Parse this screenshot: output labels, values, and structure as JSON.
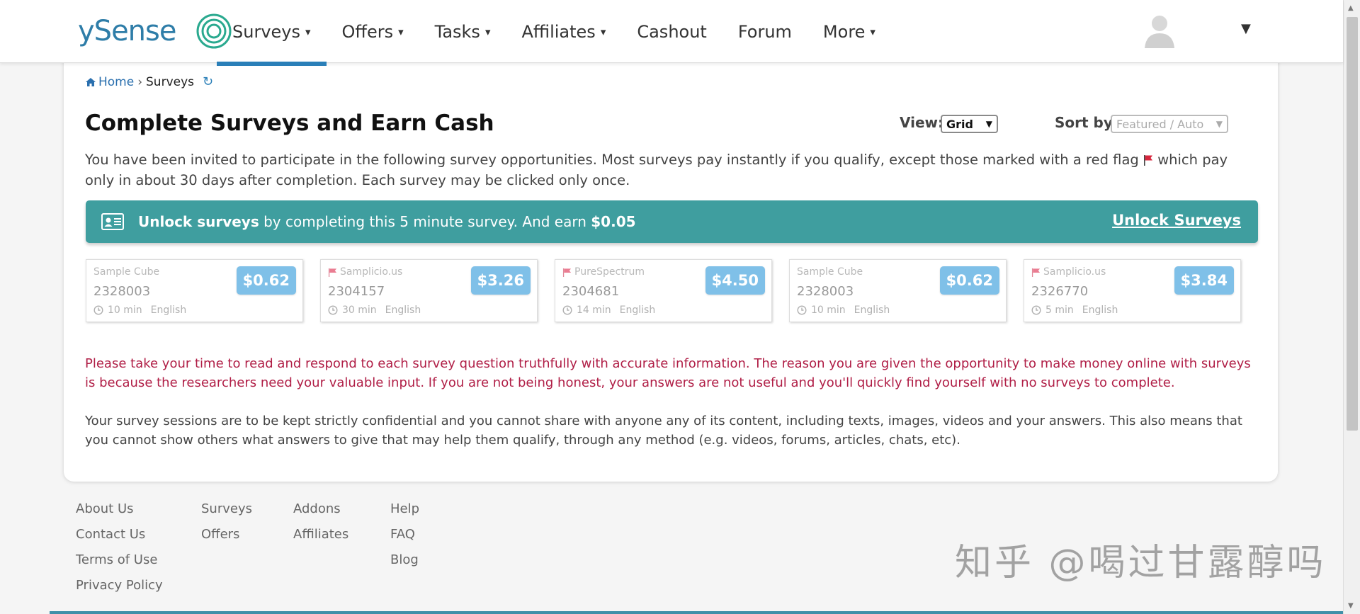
{
  "header": {
    "logo_text": "ySense",
    "nav": [
      {
        "label": "Surveys",
        "dropdown": true
      },
      {
        "label": "Offers",
        "dropdown": true
      },
      {
        "label": "Tasks",
        "dropdown": true
      },
      {
        "label": "Affiliates",
        "dropdown": true
      },
      {
        "label": "Cashout",
        "dropdown": false
      },
      {
        "label": "Forum",
        "dropdown": false
      },
      {
        "label": "More",
        "dropdown": true
      }
    ],
    "active_nav": "Surveys",
    "caret": "▾",
    "user_caret": "▼"
  },
  "breadcrumb": {
    "home": "Home",
    "sep": "›",
    "current": "Surveys",
    "refresh_icon": "↻"
  },
  "main": {
    "title": "Complete Surveys and Earn Cash",
    "view_label": "View:",
    "view_value": "Grid",
    "sort_label": "Sort by:",
    "sort_value": "Featured / Auto",
    "select_arrow": "▼",
    "intro_part1": "You have been invited to participate in the following survey opportunities. Most surveys pay instantly if you qualify, except those marked with a red flag",
    "intro_part2": "which pay only in about 30 days after completion. Each survey may be clicked only once."
  },
  "banner": {
    "bold1": "Unlock surveys",
    "text": " by completing this 5 minute survey. And earn ",
    "amount": "$0.05",
    "link": "Unlock Surveys"
  },
  "surveys": [
    {
      "provider": "Sample Cube",
      "id": "2328003",
      "time": "10 min",
      "lang": "English",
      "price": "$0.62",
      "flag": false
    },
    {
      "provider": "Samplicio.us",
      "id": "2304157",
      "time": "30 min",
      "lang": "English",
      "price": "$3.26",
      "flag": true
    },
    {
      "provider": "PureSpectrum",
      "id": "2304681",
      "time": "14 min",
      "lang": "English",
      "price": "$4.50",
      "flag": true
    },
    {
      "provider": "Sample Cube",
      "id": "2328003",
      "time": "10 min",
      "lang": "English",
      "price": "$0.62",
      "flag": false
    },
    {
      "provider": "Samplicio.us",
      "id": "2326770",
      "time": "5 min",
      "lang": "English",
      "price": "$3.84",
      "flag": true
    }
  ],
  "notices": {
    "warning": "Please take your time to read and respond to each survey question truthfully with accurate information. The reason you are given the opportunity to make money online with surveys is because the researchers need your valuable input. If you are not being honest, your answers are not useful and you'll quickly find yourself with no surveys to complete.",
    "confidential": "Your survey sessions are to be kept strictly confidential and you cannot share with anyone any of its content, including texts, images, videos and your answers. This also means that you cannot show others what answers to give that may help them qualify, through any method (e.g. videos, forums, articles, chats, etc)."
  },
  "footer": {
    "col1": [
      "About Us",
      "Contact Us",
      "Terms of Use",
      "Privacy Policy"
    ],
    "col2": [
      "Surveys",
      "Offers"
    ],
    "col3": [
      "Addons",
      "Affiliates"
    ],
    "col4": [
      "Help",
      "FAQ",
      "Blog"
    ]
  },
  "watermark": "知乎 @喝过甘露醇吗",
  "colors": {
    "accent": "#2a7fb8",
    "banner": "#3f9e9f",
    "price": "#7fc0e8",
    "warning": "#b01e46",
    "flag": "#d7263d"
  }
}
